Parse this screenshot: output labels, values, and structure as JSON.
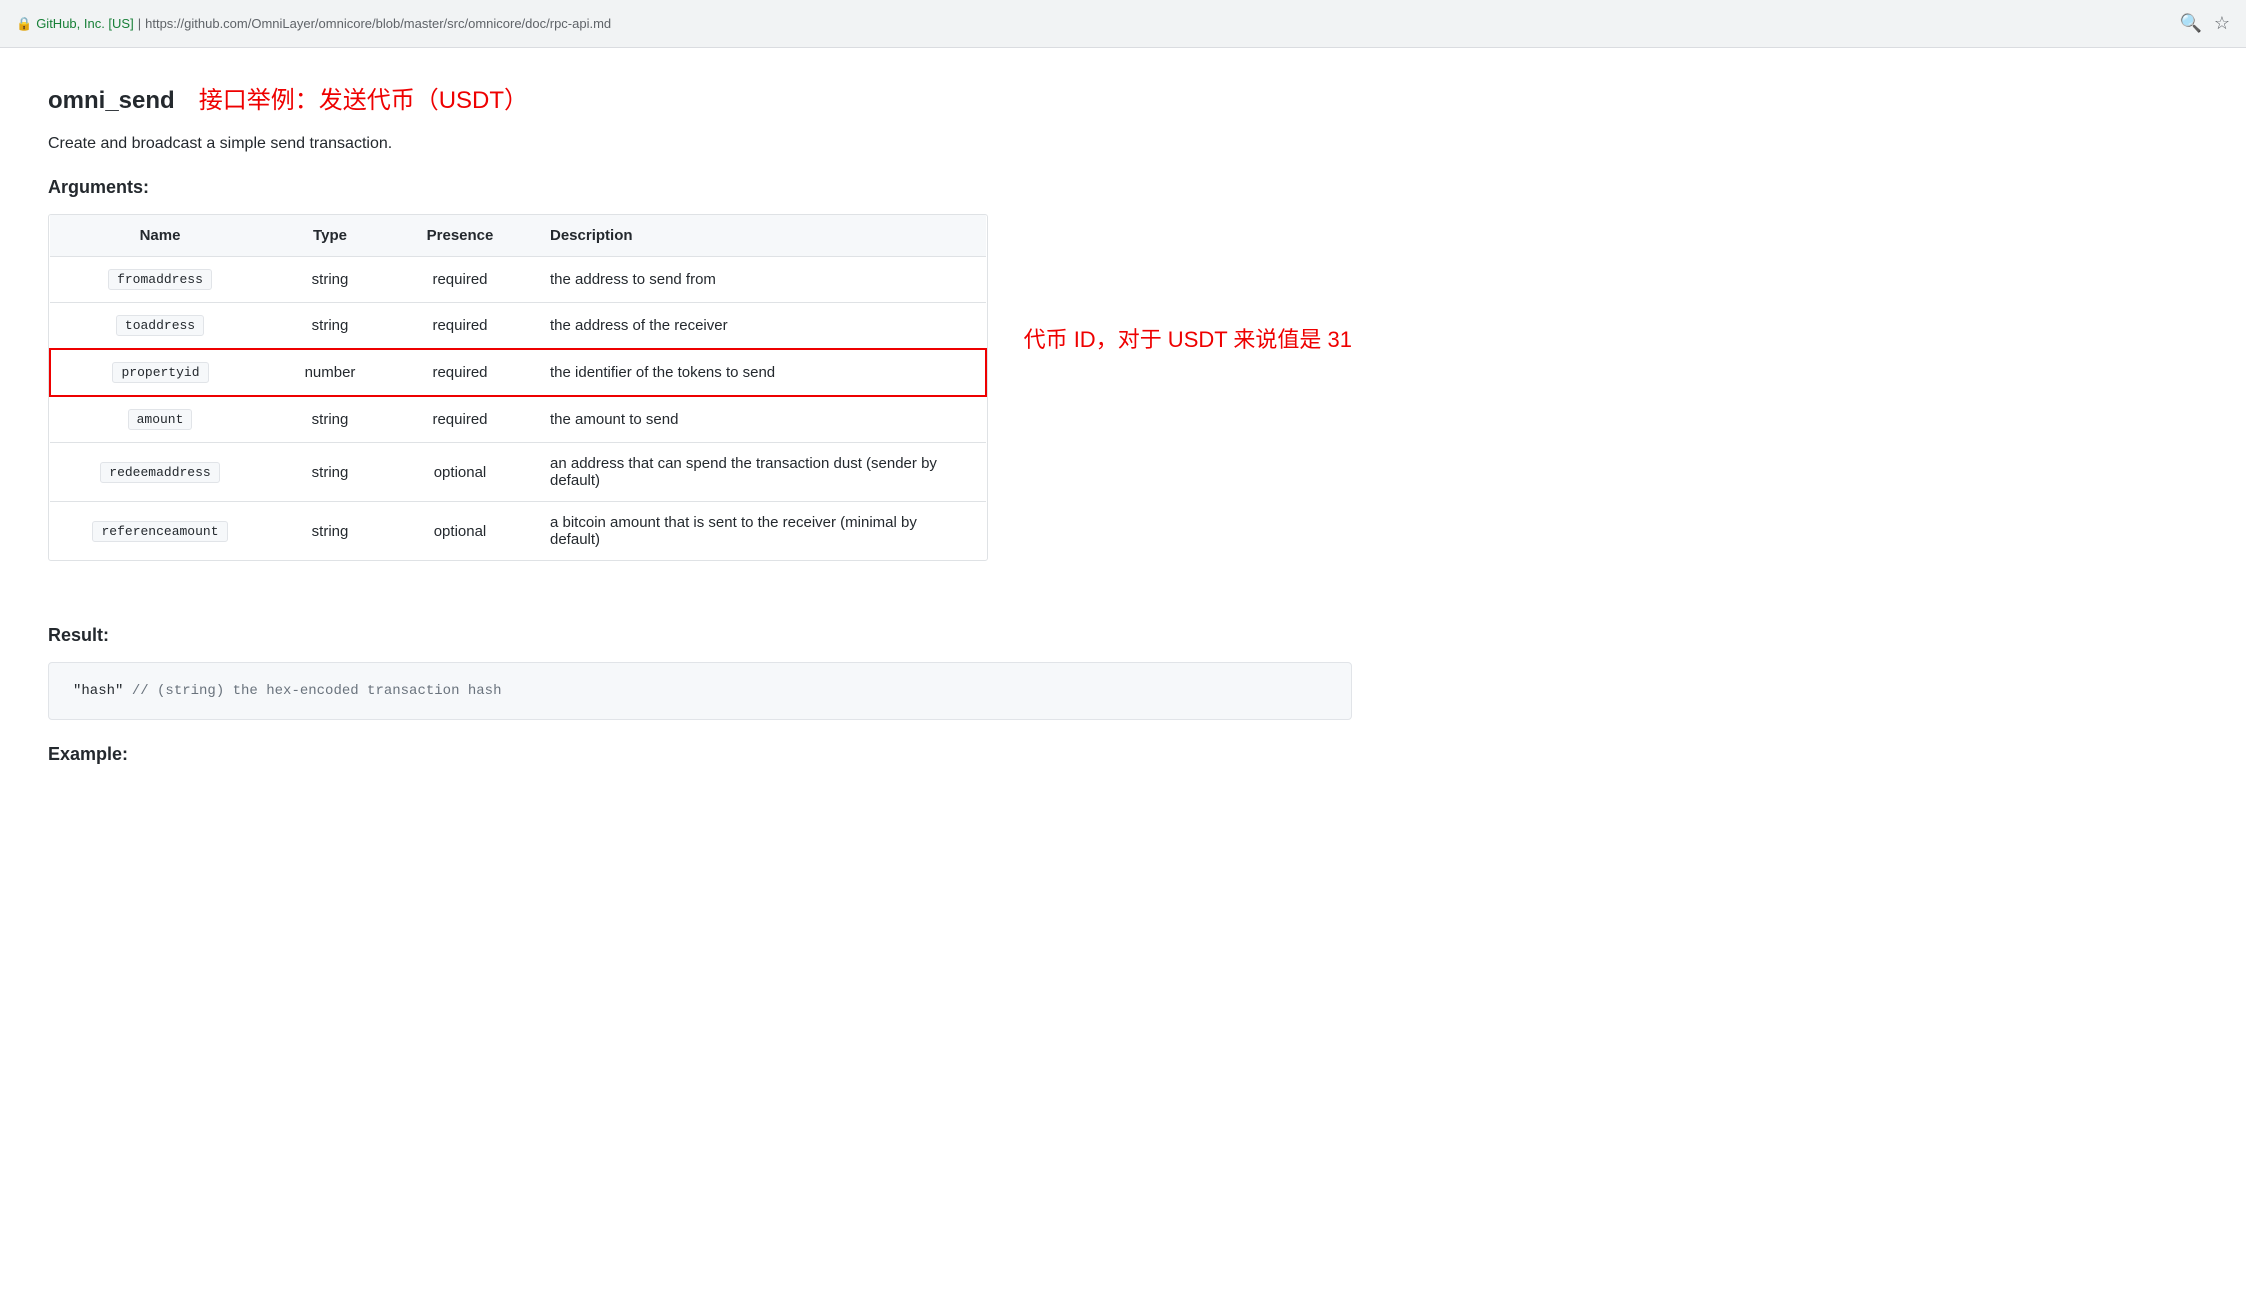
{
  "browser": {
    "security_label": "GitHub, Inc. [US]",
    "url_full": "https://github.com/OmniLayer/omnicore/blob/master/src/omnicore/doc/rpc-api.md",
    "url_org": "github.com",
    "url_path": "/OmniLayer/omnicore/blob/master/src/omnicore/doc/rpc-api.md"
  },
  "page": {
    "api_name": "omni_send",
    "api_subtitle": "接口举例：发送代币（USDT）",
    "description": "Create and broadcast a simple send transaction.",
    "arguments_label": "Arguments:",
    "table": {
      "headers": [
        "Name",
        "Type",
        "Presence",
        "Description"
      ],
      "rows": [
        {
          "name": "fromaddress",
          "type": "string",
          "presence": "required",
          "description": "the address to send from",
          "highlighted": false
        },
        {
          "name": "toaddress",
          "type": "string",
          "presence": "required",
          "description": "the address of the receiver",
          "highlighted": false
        },
        {
          "name": "propertyid",
          "type": "number",
          "presence": "required",
          "description": "the identifier of the tokens to send",
          "highlighted": true,
          "annotation": "代币 ID，对于 USDT 来说值是 31"
        },
        {
          "name": "amount",
          "type": "string",
          "presence": "required",
          "description": "the amount to send",
          "highlighted": false
        },
        {
          "name": "redeemaddress",
          "type": "string",
          "presence": "optional",
          "description": "an address that can spend the transaction dust (sender by default)",
          "highlighted": false
        },
        {
          "name": "referenceamount",
          "type": "string",
          "presence": "optional",
          "description": "a bitcoin amount that is sent to the receiver (minimal by default)",
          "highlighted": false
        }
      ]
    },
    "result_label": "Result:",
    "code_block": "\"hash\"  // (string) the hex-encoded transaction hash",
    "example_label": "Example:"
  }
}
